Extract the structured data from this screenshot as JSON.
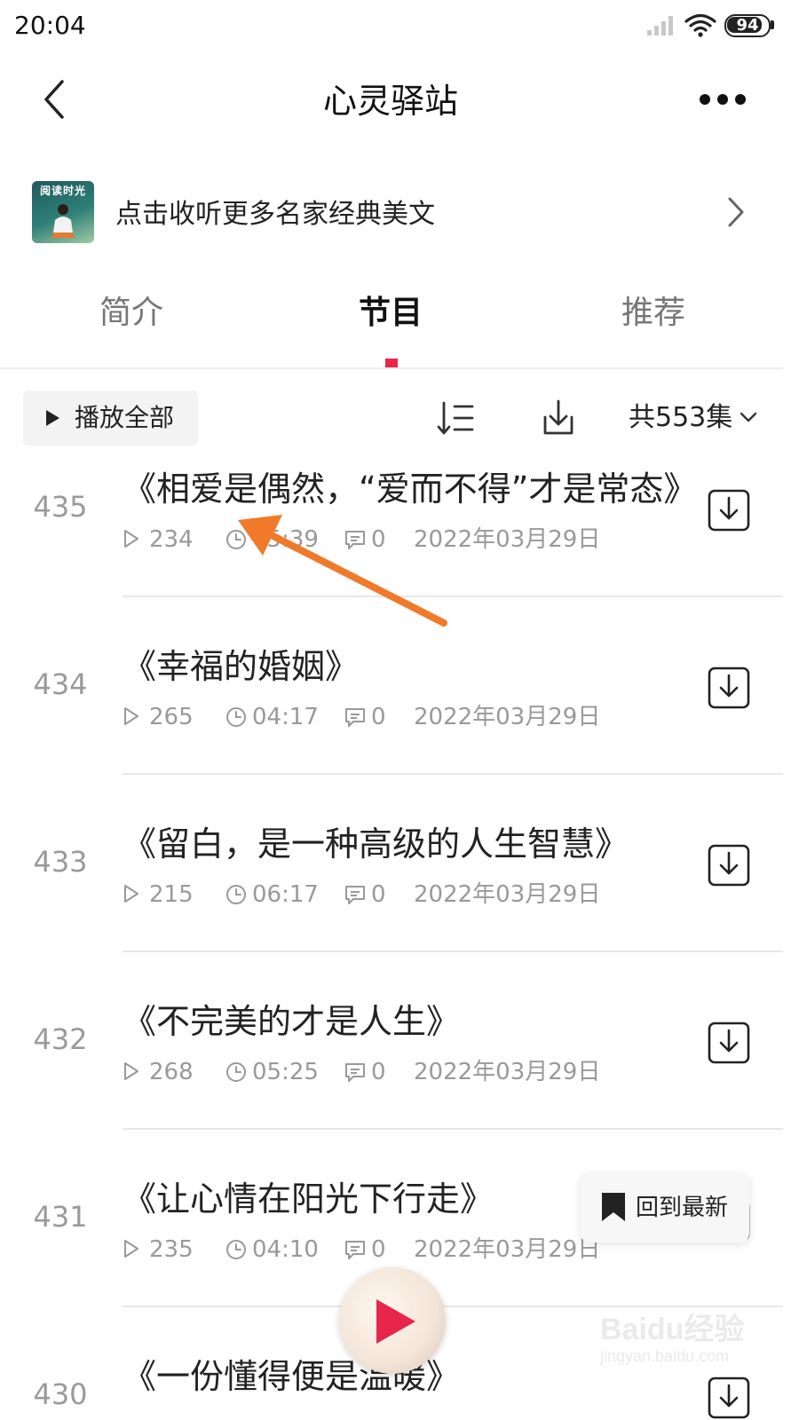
{
  "status_bar": {
    "time": "20:04",
    "battery_level": "94",
    "battery_fraction": 0.94
  },
  "nav": {
    "title": "心灵驿站"
  },
  "banner": {
    "thumb_caption": "阅读时光",
    "text": "点击收听更多名家经典美文"
  },
  "tabs": [
    {
      "label": "简介",
      "active": false
    },
    {
      "label": "节目",
      "active": true
    },
    {
      "label": "推荐",
      "active": false
    }
  ],
  "toolbar": {
    "play_all_label": "播放全部",
    "count_label": "共553集"
  },
  "episodes": [
    {
      "number": "435",
      "title": "《相爱是偶然，“爱而不得”才是常态》",
      "plays": "234",
      "duration": "05:39",
      "comments": "0",
      "date": "2022年03月29日"
    },
    {
      "number": "434",
      "title": "《幸福的婚姻》",
      "plays": "265",
      "duration": "04:17",
      "comments": "0",
      "date": "2022年03月29日"
    },
    {
      "number": "433",
      "title": "《留白，是一种高级的人生智慧》",
      "plays": "215",
      "duration": "06:17",
      "comments": "0",
      "date": "2022年03月29日"
    },
    {
      "number": "432",
      "title": "《不完美的才是人生》",
      "plays": "268",
      "duration": "05:25",
      "comments": "0",
      "date": "2022年03月29日"
    },
    {
      "number": "431",
      "title": "《让心情在阳光下行走》",
      "plays": "235",
      "duration": "04:10",
      "comments": "0",
      "date": "2022年03月29日"
    },
    {
      "number": "430",
      "title": "《一份懂得便是温暖》",
      "plays": "",
      "duration": "",
      "comments": "",
      "date": ""
    }
  ],
  "floating": {
    "back_to_latest_label": "回到最新"
  },
  "watermark": {
    "brand": "Baidu经验",
    "url": "jingyan.baidu.com"
  },
  "colors": {
    "accent": "#e8254a",
    "arrow": "#f07a2a"
  },
  "icons": [
    "signal-icon",
    "wifi-icon",
    "battery-icon",
    "back-icon",
    "more-icon",
    "chevron-right-icon",
    "play-icon",
    "sort-icon",
    "download-icon",
    "chevron-down-icon",
    "clock-icon",
    "comment-icon",
    "bookmark-icon"
  ]
}
